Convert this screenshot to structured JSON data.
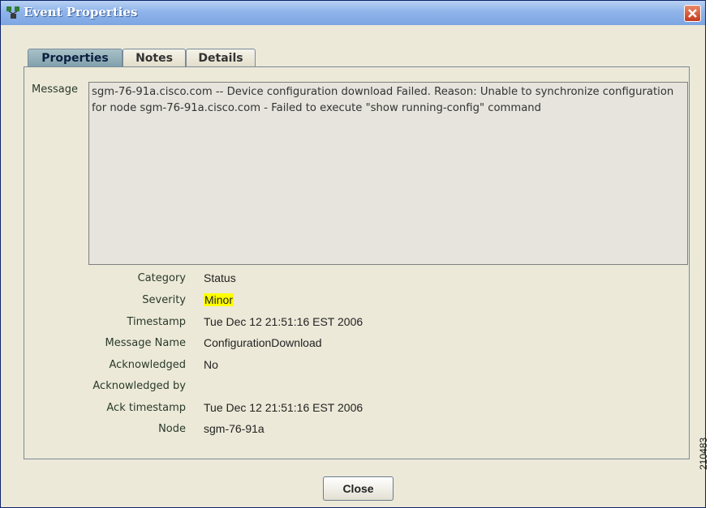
{
  "window": {
    "title": "Event Properties"
  },
  "tabs": [
    {
      "label": "Properties",
      "active": true
    },
    {
      "label": "Notes",
      "active": false
    },
    {
      "label": "Details",
      "active": false
    }
  ],
  "message": {
    "label": "Message",
    "text": "sgm-76-91a.cisco.com -- Device configuration download Failed. Reason: Unable to synchronize configuration for node sgm-76-91a.cisco.com - Failed to execute \"show running-config\" command"
  },
  "properties": [
    {
      "label": "Category",
      "value": "Status"
    },
    {
      "label": "Severity",
      "value": "Minor",
      "highlight": "#ffff00"
    },
    {
      "label": "Timestamp",
      "value": "Tue Dec 12  21:51:16 EST 2006"
    },
    {
      "label": "Message Name",
      "value": "ConfigurationDownload"
    },
    {
      "label": "Acknowledged",
      "value": "No"
    },
    {
      "label": "Acknowledged by",
      "value": ""
    },
    {
      "label": "Ack timestamp",
      "value": "Tue Dec 12  21:51:16 EST 2006"
    },
    {
      "label": "Node",
      "value": "sgm-76-91a"
    }
  ],
  "buttons": {
    "close_label": "Close"
  },
  "figure_code": "210483",
  "icons": {
    "app": "network-nodes-icon",
    "close": "close-icon"
  },
  "colors": {
    "titlebar": "#8eb4ea",
    "severity_highlight": "#ffff00",
    "active_tab": "#7f9fab"
  }
}
